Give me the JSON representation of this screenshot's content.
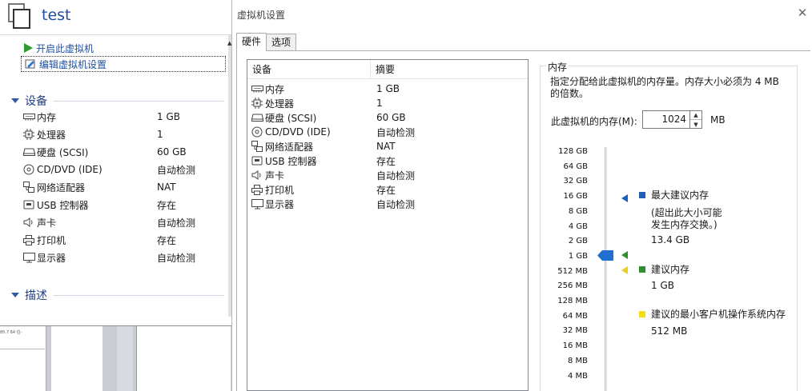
{
  "vm": {
    "title": "test",
    "actions": {
      "power_on": "开启此虚拟机",
      "edit_settings": "编辑虚拟机设置"
    },
    "devices_section": "设备",
    "description_section": "描述",
    "devices": [
      {
        "name": "内存",
        "value": "1 GB",
        "icon": "memory-icon"
      },
      {
        "name": "处理器",
        "value": "1",
        "icon": "cpu-icon"
      },
      {
        "name": "硬盘 (SCSI)",
        "value": "60 GB",
        "icon": "disk-icon"
      },
      {
        "name": "CD/DVD (IDE)",
        "value": "自动检测",
        "icon": "cd-icon"
      },
      {
        "name": "网络适配器",
        "value": "NAT",
        "icon": "network-icon"
      },
      {
        "name": "USB 控制器",
        "value": "存在",
        "icon": "usb-icon"
      },
      {
        "name": "声卡",
        "value": "自动检测",
        "icon": "speaker-icon"
      },
      {
        "name": "打印机",
        "value": "存在",
        "icon": "printer-icon"
      },
      {
        "name": "显示器",
        "value": "自动检测",
        "icon": "monitor-icon"
      }
    ]
  },
  "background": {
    "snippet": "85.7 64 位-"
  },
  "dialog": {
    "title": "虚拟机设置",
    "close": "✕",
    "tabs": [
      {
        "label": "硬件",
        "active": true
      },
      {
        "label": "选项",
        "active": false
      }
    ],
    "list_headers": {
      "device": "设备",
      "summary": "摘要"
    },
    "memory": {
      "group_title": "内存",
      "description": "指定分配给此虚拟机的内存量。内存大小必须为 4 MB 的倍数。",
      "field_label": "此虚拟机的内存(M):",
      "value": "1024",
      "unit": "MB",
      "scale": [
        "128 GB",
        "64 GB",
        "32 GB",
        "16 GB",
        "8 GB",
        "4 GB",
        "2 GB",
        "1 GB",
        "512 MB",
        "256 MB",
        "128 MB",
        "64 MB",
        "32 MB",
        "16 MB",
        "8 MB",
        "4 MB"
      ],
      "max_recommended": {
        "label": "最大建议内存",
        "note": "(超出此大小可能发生内存交换。)",
        "value": "13.4 GB",
        "color": "#1f5fb5"
      },
      "recommended": {
        "label": "建议内存",
        "value": "1 GB",
        "color": "#2f8f2f"
      },
      "min_guest": {
        "label": "建议的最小客户机操作系统内存",
        "value": "512 MB",
        "color": "#f2de13"
      }
    }
  }
}
